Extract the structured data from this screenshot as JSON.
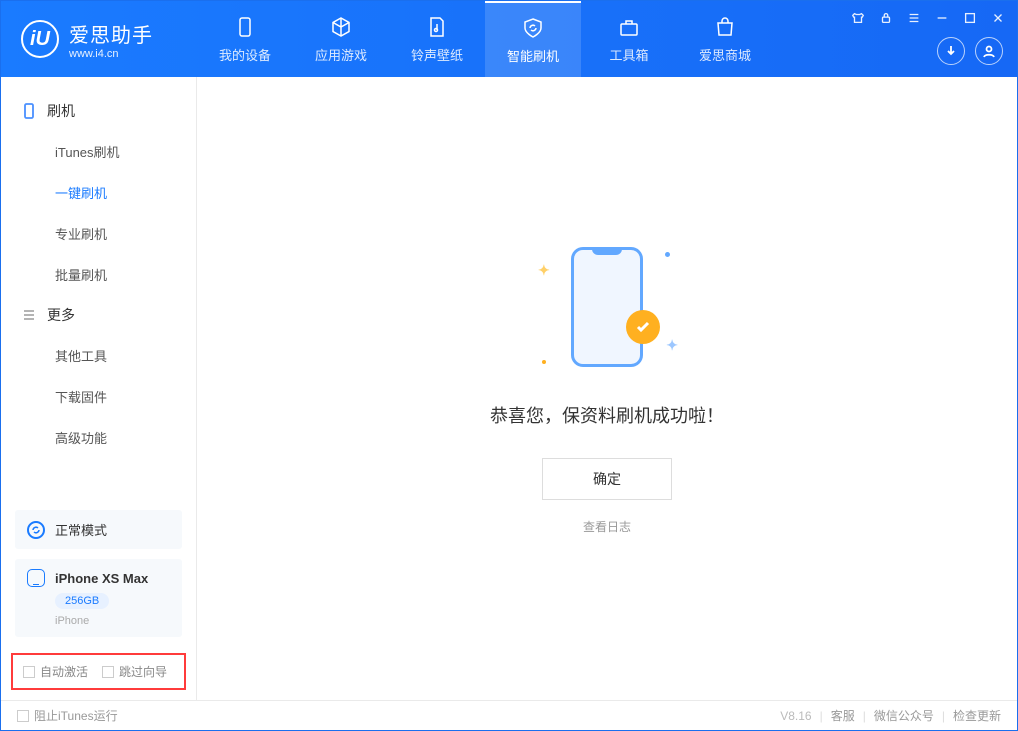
{
  "logo": {
    "title": "爱思助手",
    "subtitle": "www.i4.cn",
    "badge": "iU"
  },
  "tabs": [
    {
      "label": "我的设备"
    },
    {
      "label": "应用游戏"
    },
    {
      "label": "铃声壁纸"
    },
    {
      "label": "智能刷机"
    },
    {
      "label": "工具箱"
    },
    {
      "label": "爱思商城"
    }
  ],
  "sidebar": {
    "group_flash": "刷机",
    "items_flash": [
      "iTunes刷机",
      "一键刷机",
      "专业刷机",
      "批量刷机"
    ],
    "group_more": "更多",
    "items_more": [
      "其他工具",
      "下载固件",
      "高级功能"
    ]
  },
  "mode": {
    "label": "正常模式"
  },
  "device": {
    "name": "iPhone XS Max",
    "storage": "256GB",
    "type": "iPhone"
  },
  "checks": {
    "auto_activate": "自动激活",
    "skip_guide": "跳过向导"
  },
  "main": {
    "success_msg": "恭喜您，保资料刷机成功啦！",
    "confirm": "确定",
    "view_log": "查看日志"
  },
  "footer": {
    "block_itunes": "阻止iTunes运行",
    "version": "V8.16",
    "service": "客服",
    "wechat": "微信公众号",
    "update": "检查更新"
  }
}
